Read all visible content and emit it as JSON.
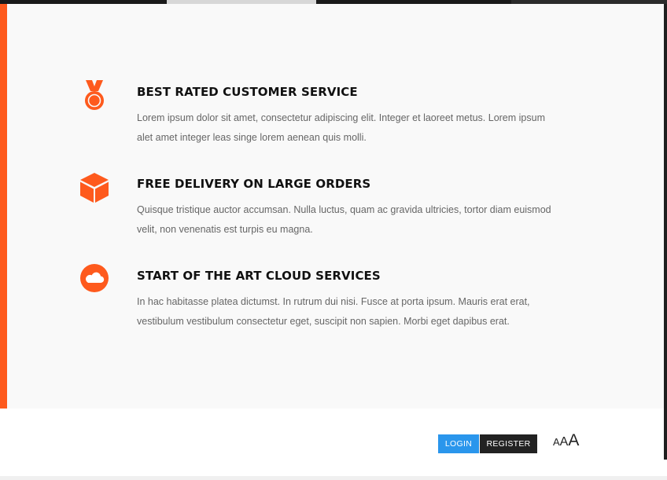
{
  "colors": {
    "accent": "#fe5a1d",
    "login": "#2a96ec",
    "register": "#222222",
    "panel_bg": "#f9f9f9",
    "text_muted": "#666666"
  },
  "features": [
    {
      "icon": "medal-icon",
      "title": "BEST RATED CUSTOMER SERVICE",
      "description": "Lorem ipsum dolor sit amet, consectetur adipiscing elit. Integer et laoreet metus. Lorem ipsum alet amet integer leas singe lorem aenean quis molli."
    },
    {
      "icon": "cube-icon",
      "title": "FREE DELIVERY ON LARGE ORDERS",
      "description": "Quisque tristique auctor accumsan. Nulla luctus, quam ac gravida ultricies, tortor diam euismod velit, non venenatis est turpis eu magna."
    },
    {
      "icon": "cloud-icon",
      "title": "START OF THE ART CLOUD SERVICES",
      "description": "In hac habitasse platea dictumst. In rutrum dui nisi. Fusce at porta ipsum. Mauris erat erat, vestibulum vestibulum consectetur eget, suscipit non sapien. Morbi eget dapibus erat."
    }
  ],
  "footer": {
    "login_label": "LOGIN",
    "register_label": "REGISTER",
    "font_size_controls": [
      "A",
      "A",
      "A"
    ]
  }
}
